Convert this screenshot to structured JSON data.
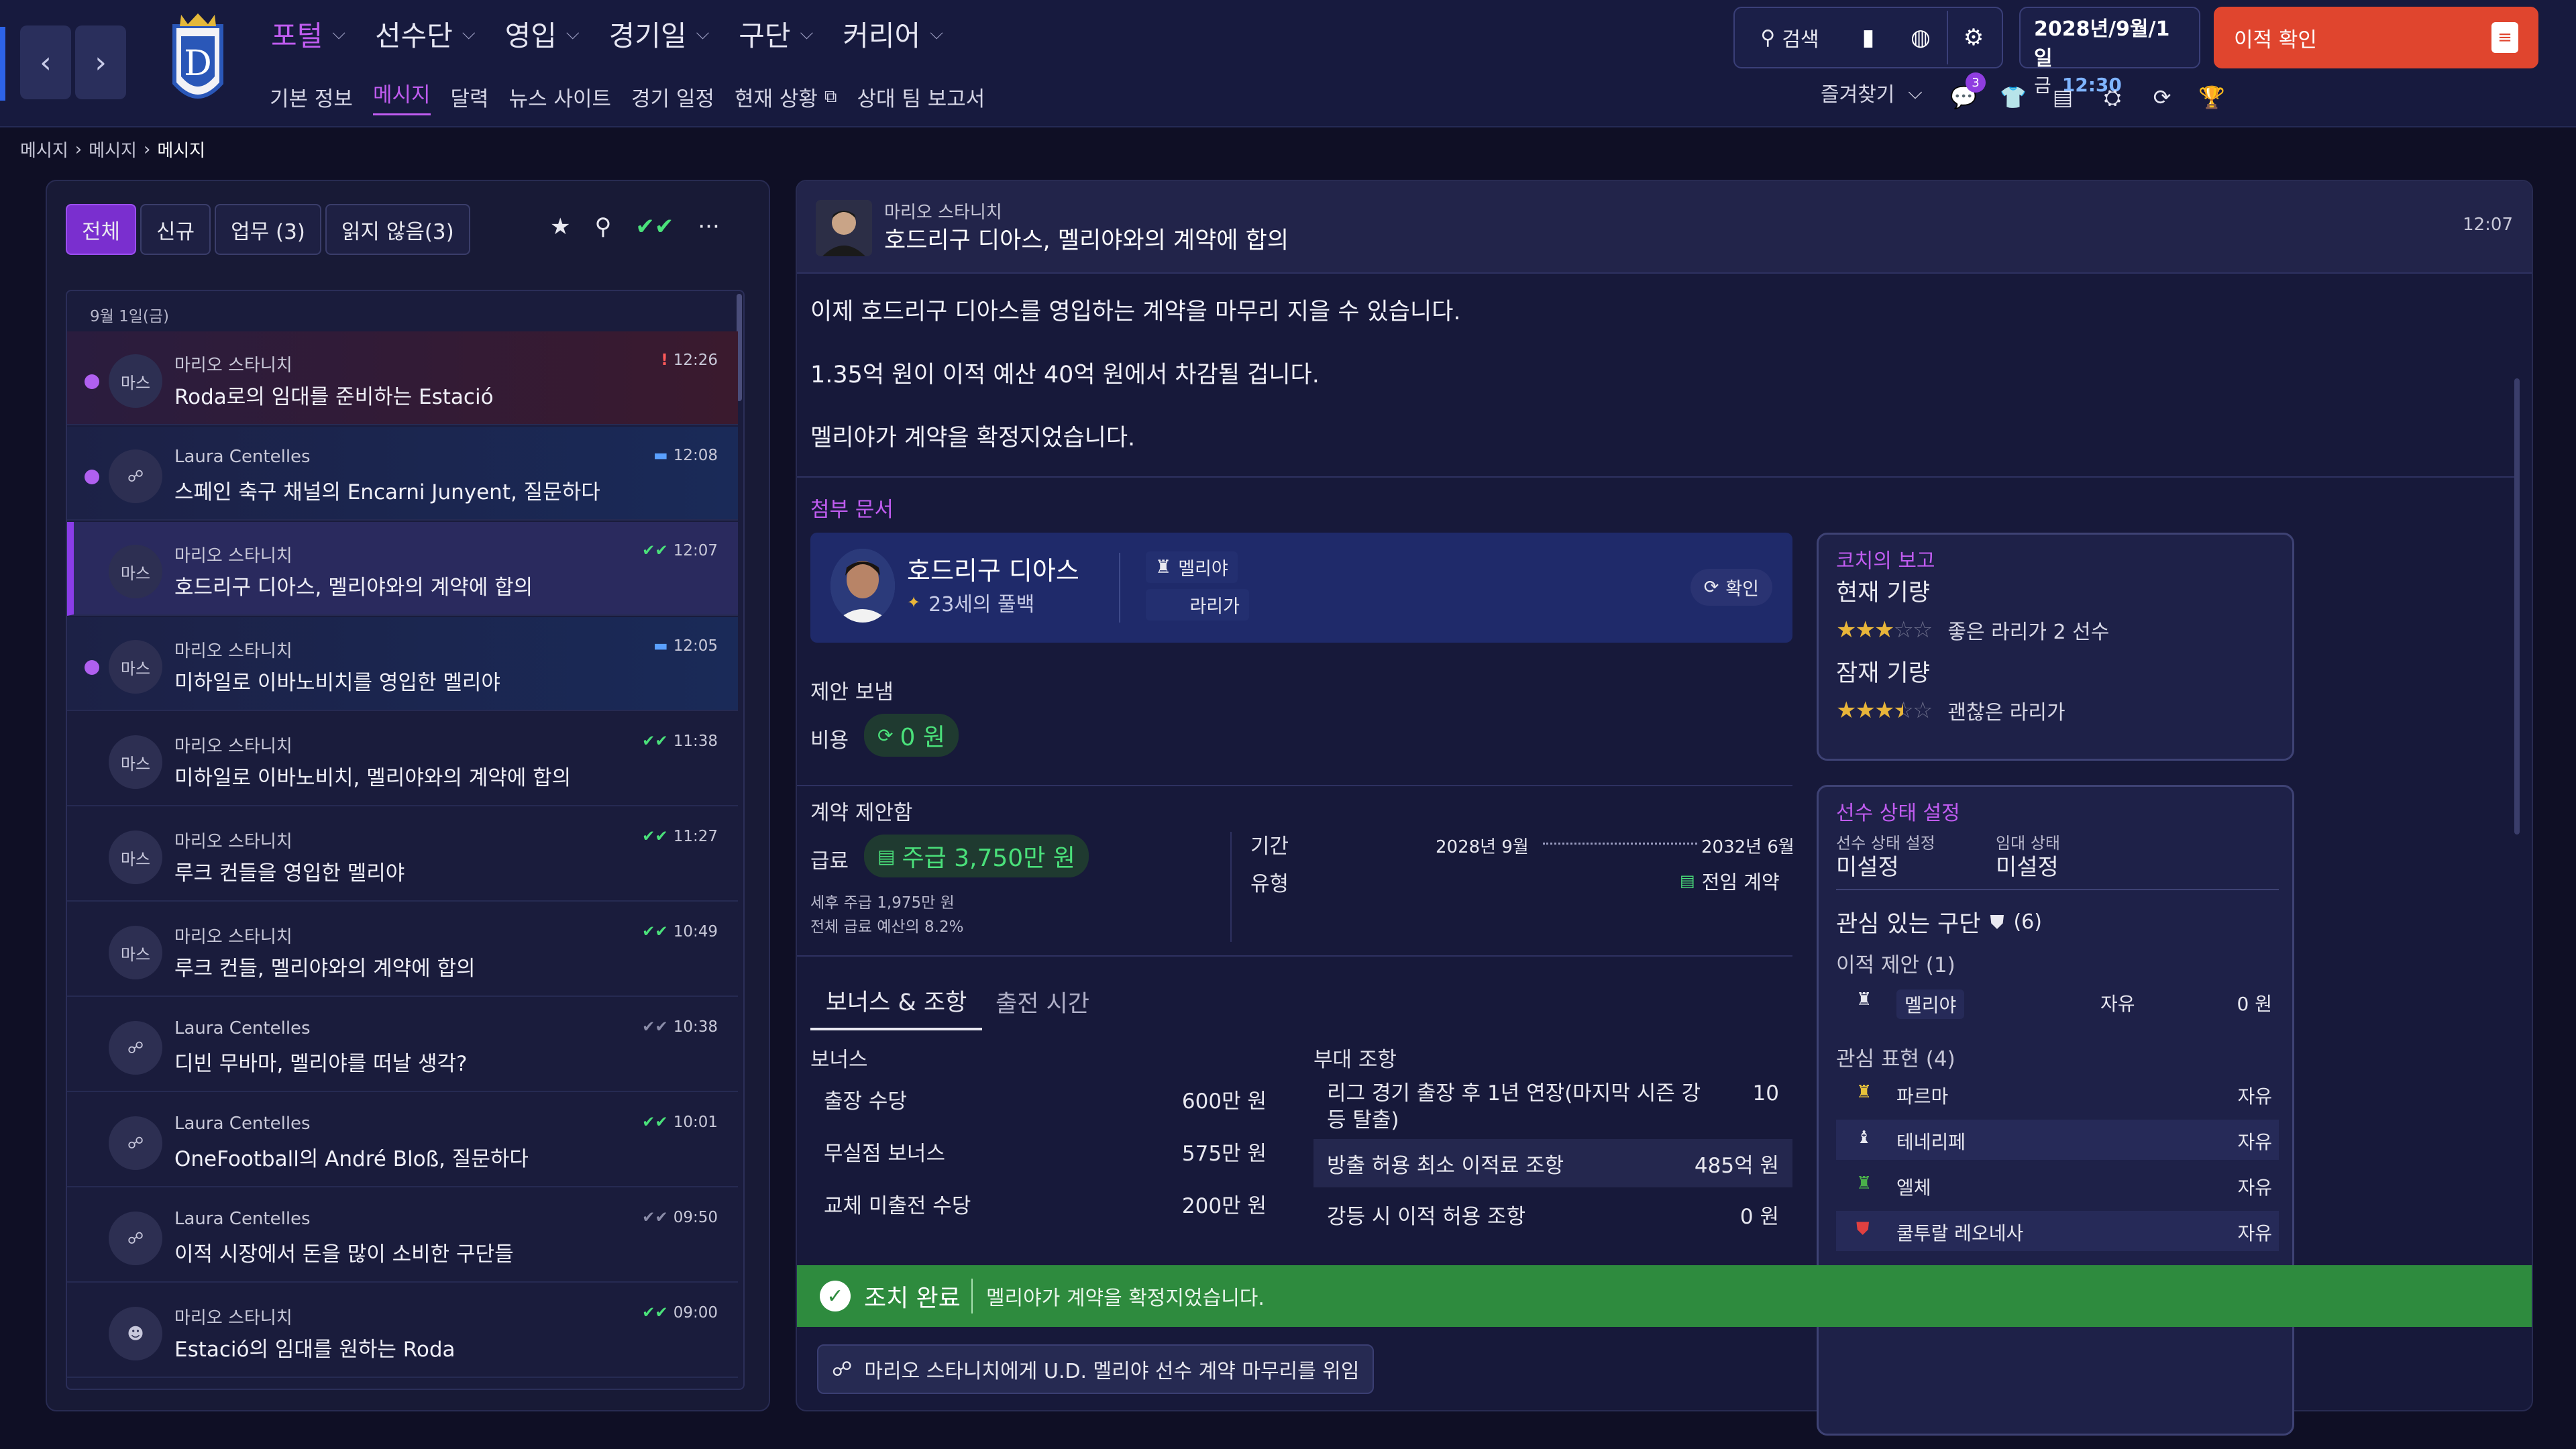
{
  "topbar": {
    "menu": [
      {
        "label": "포털",
        "active": true
      },
      {
        "label": "선수단",
        "active": false
      },
      {
        "label": "영입",
        "active": false
      },
      {
        "label": "경기일",
        "active": false
      },
      {
        "label": "구단",
        "active": false
      },
      {
        "label": "커리어",
        "active": false
      }
    ],
    "submenu": [
      "기본 정보",
      "메시지",
      "달력",
      "뉴스 사이트",
      "경기 일정",
      "현재 상황",
      "상대 팀 보고서"
    ],
    "search_label": "검색",
    "date_line1": "2028년/9월/1일",
    "date_day": "금",
    "date_time": "12:30",
    "transfer_button": "이적 확인",
    "favorites_label": "즐겨찾기",
    "notif_badge": "3"
  },
  "breadcrumb": [
    "메시지",
    "메시지",
    "메시지"
  ],
  "filters": {
    "all": "전체",
    "new": "신규",
    "tasks": "업무 (3)",
    "unread": "읽지 않음(3)"
  },
  "list_date": "9월 1일(금)",
  "messages": [
    {
      "avatar": "마스",
      "sender": "마리오 스타니치",
      "subject": "Roda로의 임대를 준비하는 Estació",
      "time": "12:26",
      "status": "!",
      "unread": true
    },
    {
      "avatar": "",
      "sender": "Laura Centelles",
      "subject": "스페인 축구 채널의 Encarni Junyent, 질문하다",
      "time": "12:08",
      "status": "chat",
      "unread": true
    },
    {
      "avatar": "마스",
      "sender": "마리오 스타니치",
      "subject": "호드리구 디아스, 멜리야와의 계약에 합의",
      "time": "12:07",
      "status": "check",
      "unread": false
    },
    {
      "avatar": "마스",
      "sender": "마리오 스타니치",
      "subject": "미하일로 이바노비치를 영입한 멜리야",
      "time": "12:05",
      "status": "chat",
      "unread": true
    },
    {
      "avatar": "마스",
      "sender": "마리오 스타니치",
      "subject": "미하일로 이바노비치, 멜리야와의 계약에 합의",
      "time": "11:38",
      "status": "check",
      "unread": false
    },
    {
      "avatar": "마스",
      "sender": "마리오 스타니치",
      "subject": "루크 컨들을 영입한 멜리야",
      "time": "11:27",
      "status": "check",
      "unread": false
    },
    {
      "avatar": "마스",
      "sender": "마리오 스타니치",
      "subject": "루크 컨들, 멜리야와의 계약에 합의",
      "time": "10:49",
      "status": "check",
      "unread": false
    },
    {
      "avatar": "",
      "sender": "Laura Centelles",
      "subject": "디빈 무바마, 멜리야를 떠날 생각?",
      "time": "10:38",
      "status": "check-grey",
      "unread": false
    },
    {
      "avatar": "",
      "sender": "Laura Centelles",
      "subject": "OneFootball의 André Bloß, 질문하다",
      "time": "10:01",
      "status": "check",
      "unread": false
    },
    {
      "avatar": "",
      "sender": "Laura Centelles",
      "subject": "이적 시장에서 돈을 많이 소비한 구단들",
      "time": "09:50",
      "status": "check-grey",
      "unread": false
    },
    {
      "avatar": "",
      "sender": "마리오 스타니치",
      "subject": "Estació의 임대를 원하는 Roda",
      "time": "09:00",
      "status": "check",
      "unread": false
    }
  ],
  "detail": {
    "sender": "마리오 스타니치",
    "subject": "호드리구 디아스, 멜리야와의 계약에 합의",
    "time": "12:07",
    "body": [
      "이제 호드리구 디아스를 영입하는 계약을 마무리 지을 수 있습니다.",
      "1.35억 원이 이적 예산 40억 원에서 차감될 겁니다.",
      "멜리야가 계약을 확정지었습니다."
    ],
    "attachment_label": "첨부 문서",
    "player": {
      "name": "호드리구 디아스",
      "desc": "23세의 풀백",
      "club": "멜리야",
      "league": "라리가",
      "confirm": "확인"
    },
    "offer_sent": "제안 보냄",
    "fee_label": "비용",
    "fee_value": "0 원",
    "contract_label": "계약 제안함",
    "wage_label": "급료",
    "wage_value": "주급 3,750만 원",
    "wage_note1": "세후 주급 1,975만 원",
    "wage_note2": "전체 급료 예산의 8.2%",
    "period_label": "기간",
    "period_start": "2028년 9월",
    "period_end": "2032년 6월",
    "type_label": "유형",
    "type_value": "전임 계약",
    "tabs": [
      "보너스 & 조항",
      "출전 시간"
    ],
    "bonus_header": "보너스",
    "bonuses": [
      {
        "label": "출장 수당",
        "value": "600만 원"
      },
      {
        "label": "무실점 보너스",
        "value": "575만 원"
      },
      {
        "label": "교체 미출전 수당",
        "value": "200만 원"
      }
    ],
    "clause_header": "부대 조항",
    "clauses": [
      {
        "label": "리그 경기 출장 후 1년 연장(마지막 시즌 강등 탈출)",
        "value": "10"
      },
      {
        "label": "방출 허용 최소 이적료 조항",
        "value": "485억 원"
      },
      {
        "label": "강등 시 이적 허용 조항",
        "value": "0 원"
      }
    ],
    "action_done_label": "조치 완료",
    "action_done_text": "멜리야가 계약을 확정지었습니다.",
    "delegate_button": "마리오 스타니치에게 U.D. 멜리야 선수 계약 마무리를 위임"
  },
  "coach_report": {
    "title": "코치의 보고",
    "current_label": "현재 기량",
    "current_stars": 3,
    "current_text": "좋은 라리가 2 선수",
    "potential_label": "잠재 기량",
    "potential_stars": 3.5,
    "potential_text": "괜찮은 라리가"
  },
  "status_card": {
    "title": "선수 상태 설정",
    "status_label": "선수 상태 설정",
    "status_value": "미설정",
    "loan_label": "임대 상태",
    "loan_value": "미설정",
    "interested_label": "관심 있는 구단",
    "interested_count": "(6)",
    "offers_label": "이적 제안 (1)",
    "offers": [
      {
        "club": "멜리야",
        "status": "자유",
        "value": "0 원"
      }
    ],
    "interest_label": "관심 표현 (4)",
    "interest": [
      {
        "club": "파르마",
        "status": "자유"
      },
      {
        "club": "테네리페",
        "status": "자유"
      },
      {
        "club": "엘체",
        "status": "자유"
      },
      {
        "club": "쿨투랄 레오네사",
        "status": "자유"
      }
    ]
  },
  "colors": {
    "accent": "#c05cf0",
    "success": "#2e8b3e",
    "transfer": "#e0452e"
  }
}
